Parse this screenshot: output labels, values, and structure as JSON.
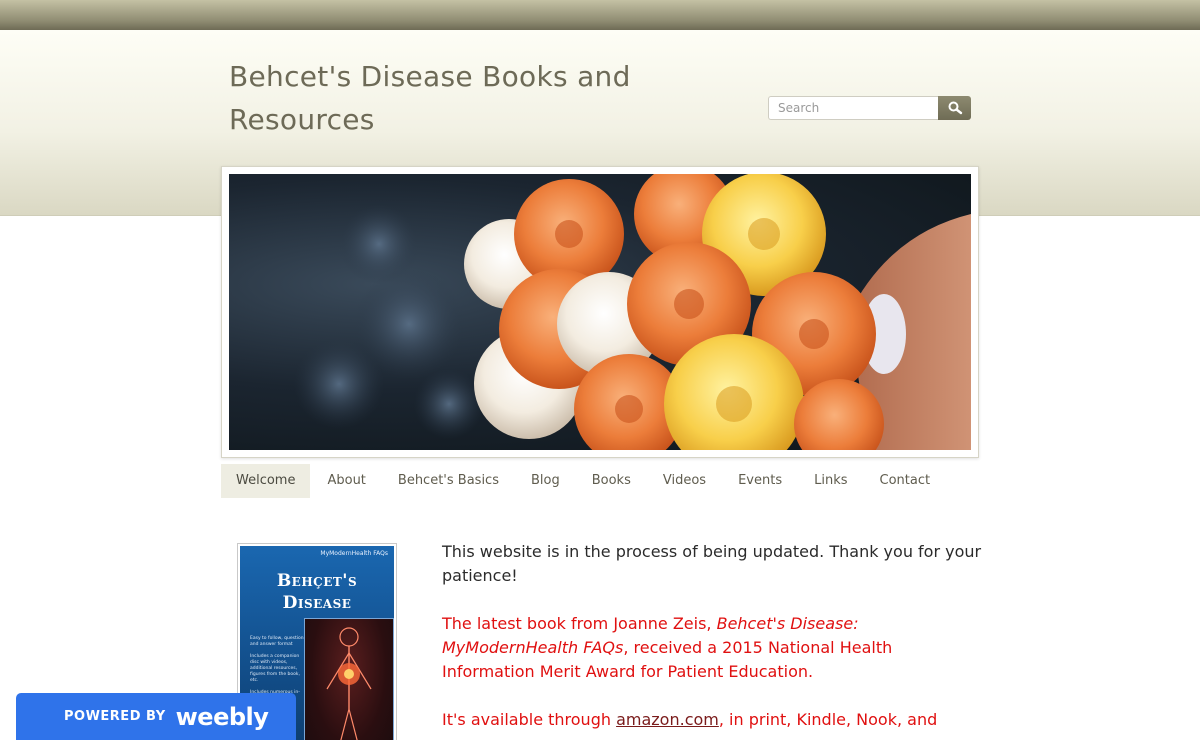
{
  "site": {
    "title": "Behcet's Disease Books and Resources"
  },
  "search": {
    "placeholder": "Search",
    "button_icon": "search-icon"
  },
  "banner": {
    "image": "bouquet of orange, yellow and white roses held in a hand"
  },
  "nav": {
    "items": [
      {
        "label": "Welcome",
        "active": true
      },
      {
        "label": "About"
      },
      {
        "label": "Behcet's Basics"
      },
      {
        "label": "Blog"
      },
      {
        "label": "Books"
      },
      {
        "label": "Videos"
      },
      {
        "label": "Events"
      },
      {
        "label": "Links"
      },
      {
        "label": "Contact"
      }
    ]
  },
  "book_cover": {
    "series": "MyModernHealth FAQs",
    "title_line1": "Behçet's",
    "title_line2": "Disease",
    "bullets": [
      "Easy to follow, question and answer format",
      "Includes a companion disc with videos, additional resources, figures from the book, etc.",
      "Includes numerous in-text"
    ]
  },
  "content": {
    "intro": "This website is in the process of being updated. Thank you for your patience!",
    "award_pre": "The latest book from Joanne Zeis, ",
    "award_title": "Behcet's Disease: MyModernHealth FAQs",
    "award_post": ", received a 2015 National Health Information Merit Award for Patient Education.",
    "avail_pre": "It's available through ",
    "avail_link": "amazon.com",
    "avail_post": ", in print, Kindle, Nook, and"
  },
  "badge": {
    "prefix": "POWERED BY",
    "brand": "weebly"
  },
  "colors": {
    "header_text": "#6d6a57",
    "nav_active_bg": "#eeede2",
    "highlight_red": "#e01010",
    "weebly_blue": "#2f73ea"
  }
}
